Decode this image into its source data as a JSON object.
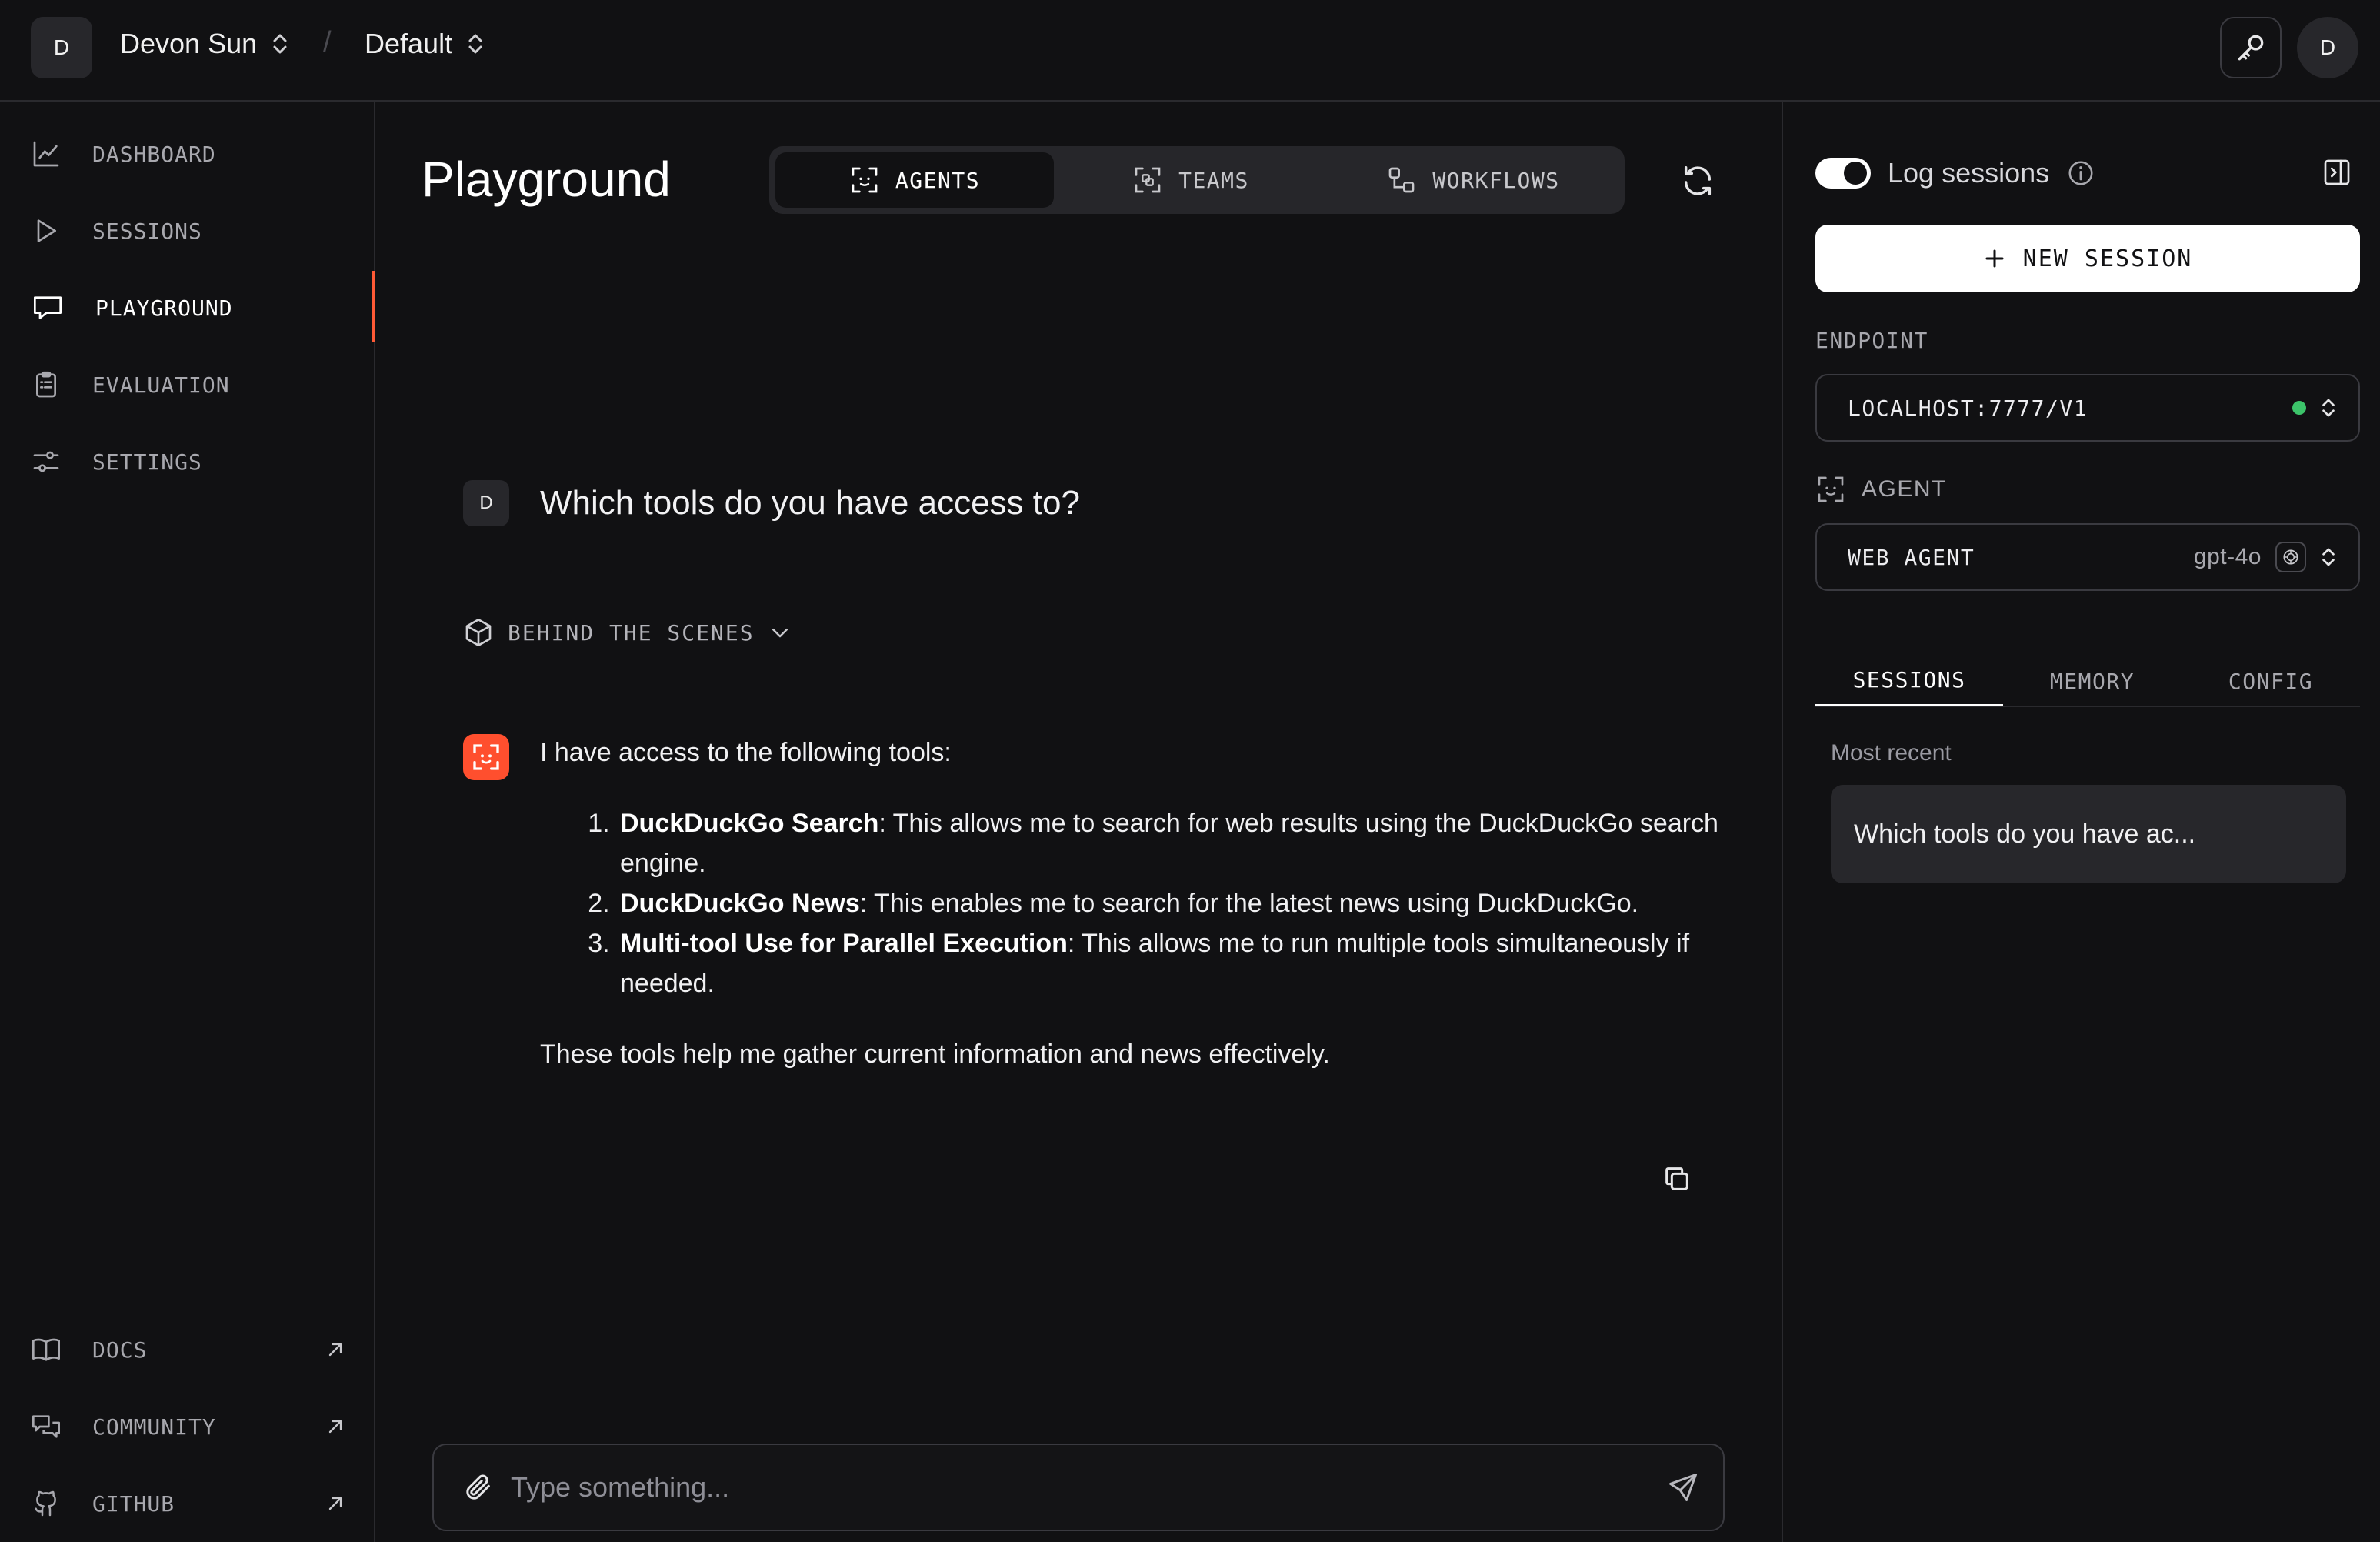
{
  "topbar": {
    "workspace_avatar": "D",
    "workspace_name": "Devon Sun",
    "separator": "/",
    "project_name": "Default",
    "user_avatar": "D"
  },
  "sidebar": {
    "items": [
      {
        "label": "DASHBOARD",
        "icon": "chart-line-icon"
      },
      {
        "label": "SESSIONS",
        "icon": "play-icon"
      },
      {
        "label": "PLAYGROUND",
        "icon": "chat-bubble-icon",
        "active": true
      },
      {
        "label": "EVALUATION",
        "icon": "clipboard-icon"
      },
      {
        "label": "SETTINGS",
        "icon": "sliders-icon"
      }
    ],
    "external_links": [
      {
        "label": "DOCS",
        "icon": "book-icon"
      },
      {
        "label": "COMMUNITY",
        "icon": "chat-bubbles-icon"
      },
      {
        "label": "GITHUB",
        "icon": "github-icon"
      }
    ]
  },
  "main": {
    "title": "Playground",
    "tabs": [
      {
        "label": "AGENTS",
        "active": true
      },
      {
        "label": "TEAMS"
      },
      {
        "label": "WORKFLOWS"
      }
    ],
    "user_message": {
      "avatar": "D",
      "text": "Which tools do you have access to?"
    },
    "behind_the_scenes": "BEHIND THE SCENES",
    "agent_response": {
      "intro": "I have access to the following tools:",
      "items": [
        {
          "title": "DuckDuckGo Search",
          "desc": ": This allows me to search for web results using the DuckDuckGo search engine."
        },
        {
          "title": "DuckDuckGo News",
          "desc": ": This enables me to search for the latest news using DuckDuckGo."
        },
        {
          "title": "Multi-tool Use for Parallel Execution",
          "desc": ": This allows me to run multiple tools simultaneously if needed."
        }
      ],
      "outro": "These tools help me gather current information and news effectively."
    },
    "composer": {
      "placeholder": "Type something..."
    }
  },
  "right_panel": {
    "log_sessions_label": "Log sessions",
    "log_sessions_enabled": true,
    "new_session_label": "NEW SESSION",
    "endpoint_label": "ENDPOINT",
    "endpoint_value": "LOCALHOST:7777/V1",
    "endpoint_status_color": "#3cc46a",
    "agent_label": "AGENT",
    "agent_value": "WEB AGENT",
    "agent_model": "gpt-4o",
    "tabs": [
      {
        "label": "SESSIONS",
        "active": true
      },
      {
        "label": "MEMORY"
      },
      {
        "label": "CONFIG"
      }
    ],
    "most_recent_label": "Most recent",
    "sessions": [
      "Which tools do you have ac..."
    ]
  },
  "colors": {
    "background": "#111113",
    "accent": "#ff5a36",
    "surface": "#27272b",
    "border": "#2a2a2e"
  }
}
